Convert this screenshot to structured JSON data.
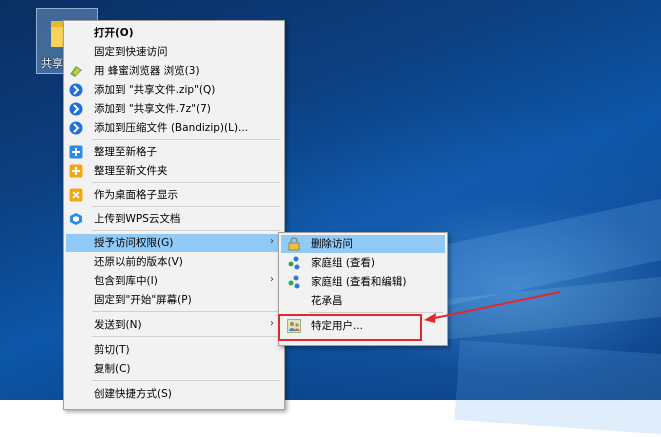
{
  "desktop": {
    "icon_label": "共享文件"
  },
  "context_menu": {
    "items": [
      {
        "label": "打开(O)",
        "icon": "none",
        "bold": true
      },
      {
        "label": "固定到快速访问",
        "icon": "none"
      },
      {
        "label": "用 蜂蜜浏览器 浏览(3)",
        "icon": "honey-browser-icon"
      },
      {
        "label": "添加到 \"共享文件.zip\"(Q)",
        "icon": "bandizip-icon"
      },
      {
        "label": "添加到 \"共享文件.7z\"(7)",
        "icon": "bandizip-icon"
      },
      {
        "label": "添加到压缩文件 (Bandizip)(L)...",
        "icon": "bandizip-icon"
      },
      {
        "label": "整理至新格子",
        "icon": "fences-icon"
      },
      {
        "label": "整理至新文件夹",
        "icon": "folder-plus-icon"
      },
      {
        "label": "作为桌面格子显示",
        "icon": "desktop-fence-icon"
      },
      {
        "label": "上传到WPS云文档",
        "icon": "wps-cloud-icon"
      },
      {
        "label": "授予访问权限(G)",
        "icon": "none",
        "has_submenu": true
      },
      {
        "label": "还原以前的版本(V)",
        "icon": "none"
      },
      {
        "label": "包含到库中(I)",
        "icon": "none",
        "has_submenu": true
      },
      {
        "label": "固定到\"开始\"屏幕(P)",
        "icon": "none"
      },
      {
        "label": "发送到(N)",
        "icon": "none",
        "has_submenu": true
      },
      {
        "label": "剪切(T)",
        "icon": "none"
      },
      {
        "label": "复制(C)",
        "icon": "none"
      },
      {
        "label": "创建快捷方式(S)",
        "icon": "none"
      }
    ],
    "submenu_arrow": "›"
  },
  "share_submenu": {
    "items": [
      {
        "label": "删除访问",
        "icon": "lock-icon"
      },
      {
        "label": "家庭组 (查看)",
        "icon": "homegroup-icon"
      },
      {
        "label": "家庭组 (查看和编辑)",
        "icon": "homegroup-icon"
      },
      {
        "label": "花承昌",
        "icon": "none"
      },
      {
        "label": "特定用户...",
        "icon": "users-icon"
      }
    ]
  },
  "colors": {
    "highlight": "#91c9f7",
    "annotation_red": "#e0282e",
    "menu_bg": "#f2f2f2"
  }
}
